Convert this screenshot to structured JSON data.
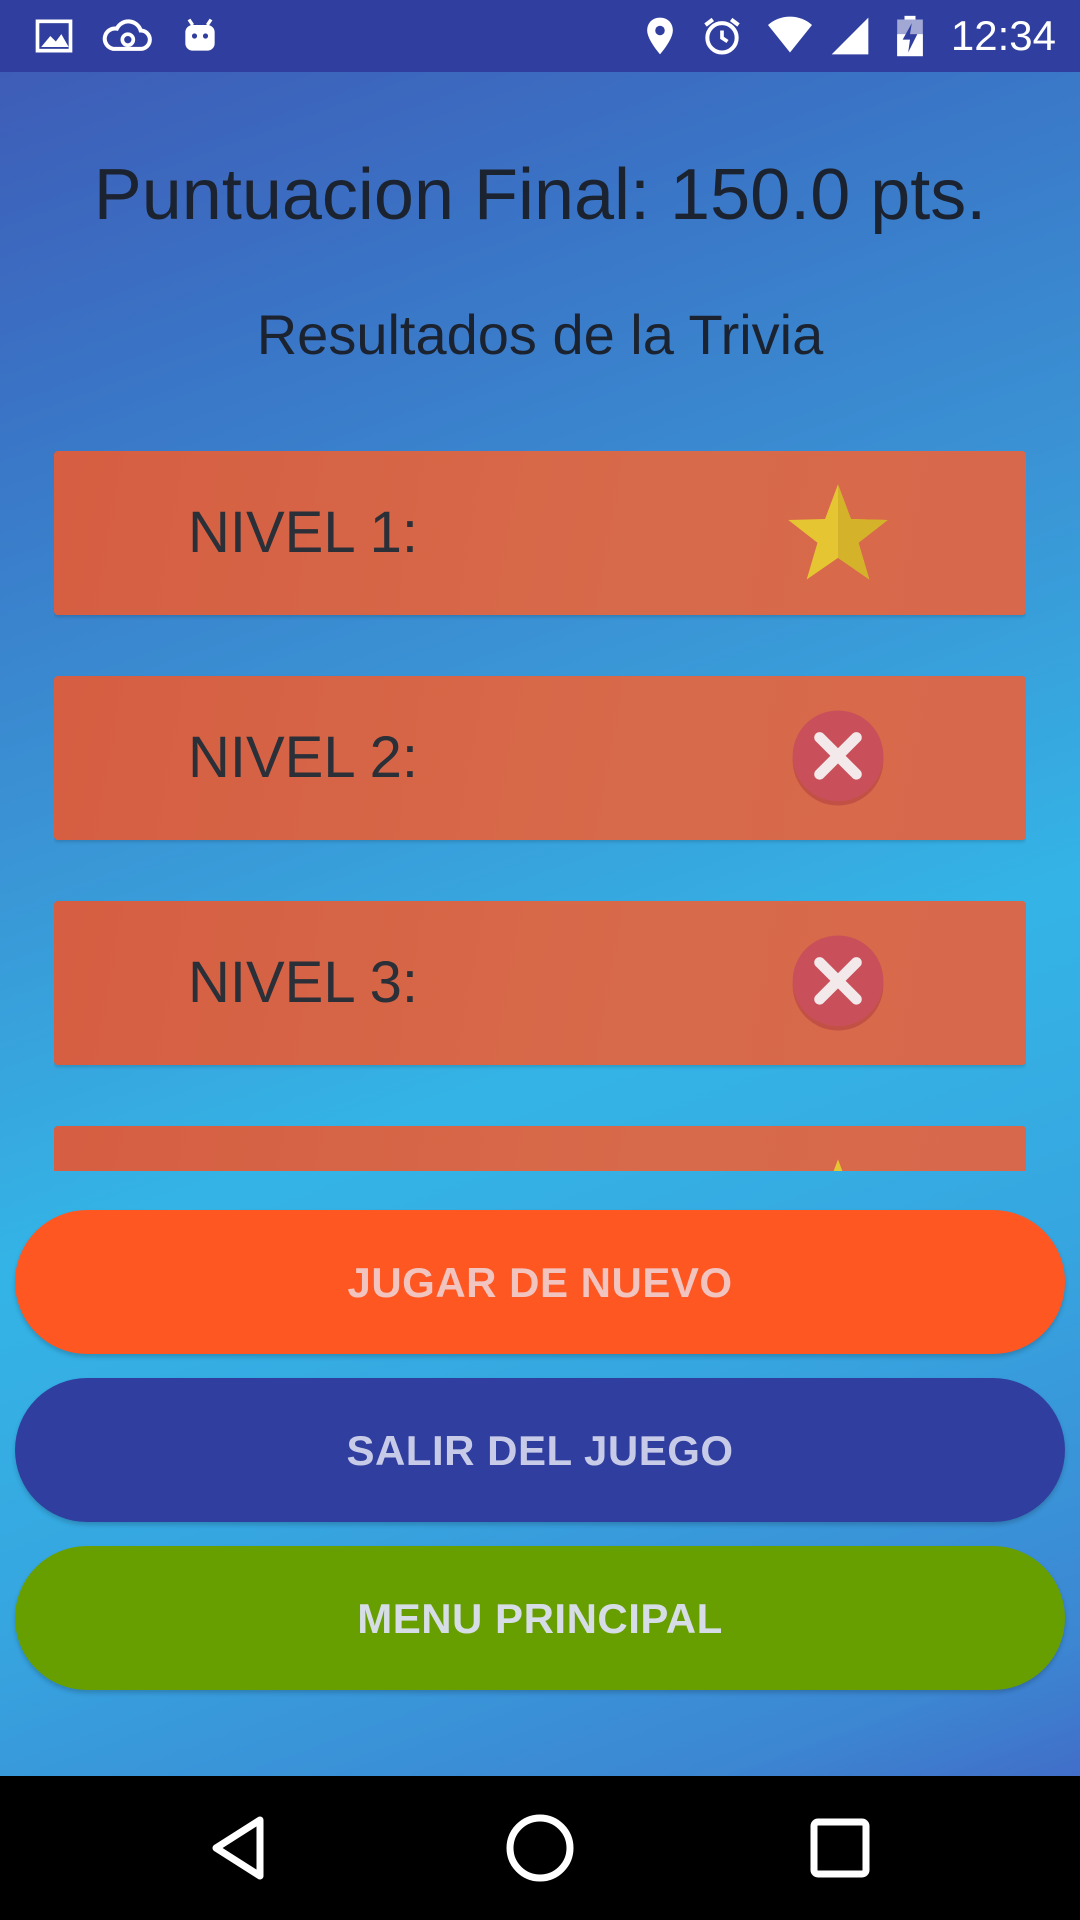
{
  "status_bar": {
    "time": "12:34",
    "left_icons": [
      "image-icon",
      "cloud-sync-icon",
      "android-icon"
    ],
    "right_icons": [
      "location-icon",
      "alarm-icon",
      "wifi-icon",
      "signal-icon",
      "battery-charging-icon"
    ]
  },
  "header": {
    "final_score": "Puntuacion Final: 150.0 pts.",
    "results_title": "Resultados de la Trivia"
  },
  "levels": [
    {
      "label": "NIVEL 1:",
      "result": "star-icon"
    },
    {
      "label": "NIVEL 2:",
      "result": "wrong-x-icon"
    },
    {
      "label": "NIVEL 3:",
      "result": "wrong-x-icon"
    },
    {
      "label": "",
      "result": "star-icon"
    }
  ],
  "buttons": {
    "play_again": "JUGAR DE NUEVO",
    "exit_game": "SALIR DEL JUEGO",
    "main_menu": "MENU PRINCIPAL"
  },
  "colors": {
    "status_bar": "#303f9f",
    "level_row": "#d76a4a",
    "play_again_button": "#ff5722",
    "exit_button": "#303f9f",
    "menu_button": "#689f00",
    "star": "#e3c233",
    "wrong_badge": "#c9505a"
  },
  "nav_bar": {
    "icons": [
      "back-icon",
      "home-icon",
      "recents-icon"
    ]
  }
}
